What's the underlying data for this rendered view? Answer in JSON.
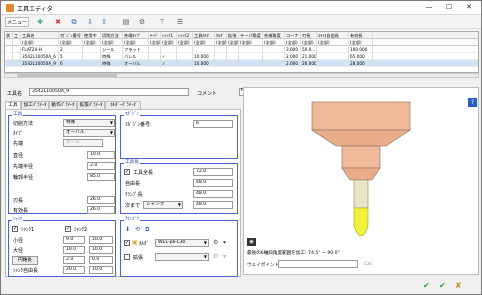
{
  "window": {
    "title": "工具エディタ",
    "min": "—",
    "max": "☐",
    "close": "✕"
  },
  "toolbar": {
    "menu_label": "メニュー"
  },
  "grid": {
    "columns": [
      "状",
      "工",
      "工具名",
      "ﾏｶﾞｼﾞﾝ番号",
      "使用中",
      "切削方法",
      "先端ﾀｲﾌﾟ",
      "ﾃｰﾊﾟ",
      "ｼｬﾝｸ1",
      "ｼｬﾝｸ2",
      "工具ﾎﾙﾀﾞ",
      "ﾎﾙﾀﾞ",
      "拡張",
      "テーパ角度",
      "先端角度",
      "コーナ",
      "刃長",
      "ｽﾗｲｽ自由長",
      "有効長"
    ],
    "filter": [
      "",
      "",
      "(全部)",
      "(全部)",
      "(全部)",
      "(全部)",
      "(全部)",
      "(全部)",
      "(全部)",
      "(全部)",
      "(全部)",
      "(全部)",
      "(全部)",
      "(全部)",
      "(全部)",
      "(全部)",
      "(全部)",
      "(全部)",
      "(全部)"
    ],
    "rows": [
      [
        "",
        "",
        "FLAT24-H",
        "2",
        "",
        "シール",
        "フラット",
        "",
        "",
        "",
        "",
        "",
        "",
        "",
        "",
        "3.000",
        "50.0...",
        "",
        "100.000"
      ],
      [
        "",
        "",
        "3542L10050A_6",
        "5",
        "",
        "特殊",
        "バレル",
        "",
        "✓",
        "",
        "10.000",
        "",
        "",
        "",
        "",
        "2.000",
        "21.000",
        "",
        "65.000"
      ],
      [
        "",
        "",
        "3542L10050A_9",
        "6",
        "",
        "特殊",
        "オーバル",
        "",
        "✓",
        "",
        "10.000",
        "",
        "",
        "",
        "",
        "2.000",
        "26.000",
        "",
        "28.000"
      ]
    ]
  },
  "tool_name": {
    "label": "工具名",
    "value": "3542L10050A_9",
    "comment_label": "コメント",
    "comment_value": "",
    "right_value": "FRANKEN"
  },
  "tabs": [
    "工具",
    "加工ﾊﾟﾗﾒｰﾀ",
    "動作ﾊﾟﾗﾒｰﾀ",
    "拡張ﾊﾟﾗﾒｰﾀ",
    "ﾎﾙﾀﾞｰﾊﾟﾗﾒｰﾀ"
  ],
  "tool_group": {
    "title": "工具",
    "cut_method_label": "切削方法",
    "cut_method_value": "特殊",
    "type_label": "ﾀｲﾌﾟ",
    "type_value": "オーバル",
    "tip_label": "先端",
    "tip_value": "ボール",
    "diameter_label": "直径",
    "diameter_value": "10.0",
    "tip_radius_label": "先端半径",
    "tip_radius_value": "2.0",
    "profile_radius_label": "輪郭半径",
    "profile_radius_value": "85.0",
    "blade_length_label": "刃長",
    "blade_length_value": "26.0",
    "effective_length_label": "有効長",
    "effective_length_value": "26.0"
  },
  "magazine_group": {
    "title": "ﾏｶﾞｼﾞﾝ",
    "number_label": "ﾏｶﾞｼﾞﾝ番号:",
    "number_value": "6"
  },
  "length_group": {
    "title": "工具長",
    "total_label": "工具全長",
    "total_value": "72.0",
    "free_label": "自由長",
    "free_value": "48.0",
    "clamp_label": "ｸﾗﾝﾌﾟ長",
    "clamp_value": "48.0",
    "next_label": "次まで",
    "next_select": "シャンク",
    "next_value": "48.0"
  },
  "shank_group": {
    "title": "ｼｬﾝｸ",
    "shank1_label": "ｼｬﾝｸ1",
    "shank2_label": "ｼｬﾝｸ2",
    "min_diam_label": "小径",
    "min_diam_1": "9.0",
    "min_diam_2": "10.0",
    "large_diam_label": "大径",
    "large_diam_1": "10.0",
    "large_diam_2": "10.0",
    "cone_label": "円錐長",
    "cone_1": "2.0",
    "cone_2": "0.0",
    "free_label": "ｼｬﾝｸ自由長",
    "free_1": "20.0",
    "free_2": "10.0"
  },
  "assembly_group": {
    "title": "ｱｾﾝﾌﾞﾘ",
    "holder_label": "ﾎﾙﾀﾞ",
    "holder_value": "WEL-p6-L30",
    "ext_label": "拡張",
    "ext_value": ""
  },
  "preview": {
    "min_angle_text": "最長の6軸斜角度範囲を加工: 74.5° ~ 90.0°",
    "waypoint_label": "ウェイポイント:",
    "waypoint_unit": "Ca/"
  },
  "colors": {
    "accent": "#1f3fae",
    "tool_shank": "#f0b99a",
    "tool_tip": "#f2f23a",
    "check_green": "#2e9e3e",
    "holder_gold": "#e8a33a"
  }
}
